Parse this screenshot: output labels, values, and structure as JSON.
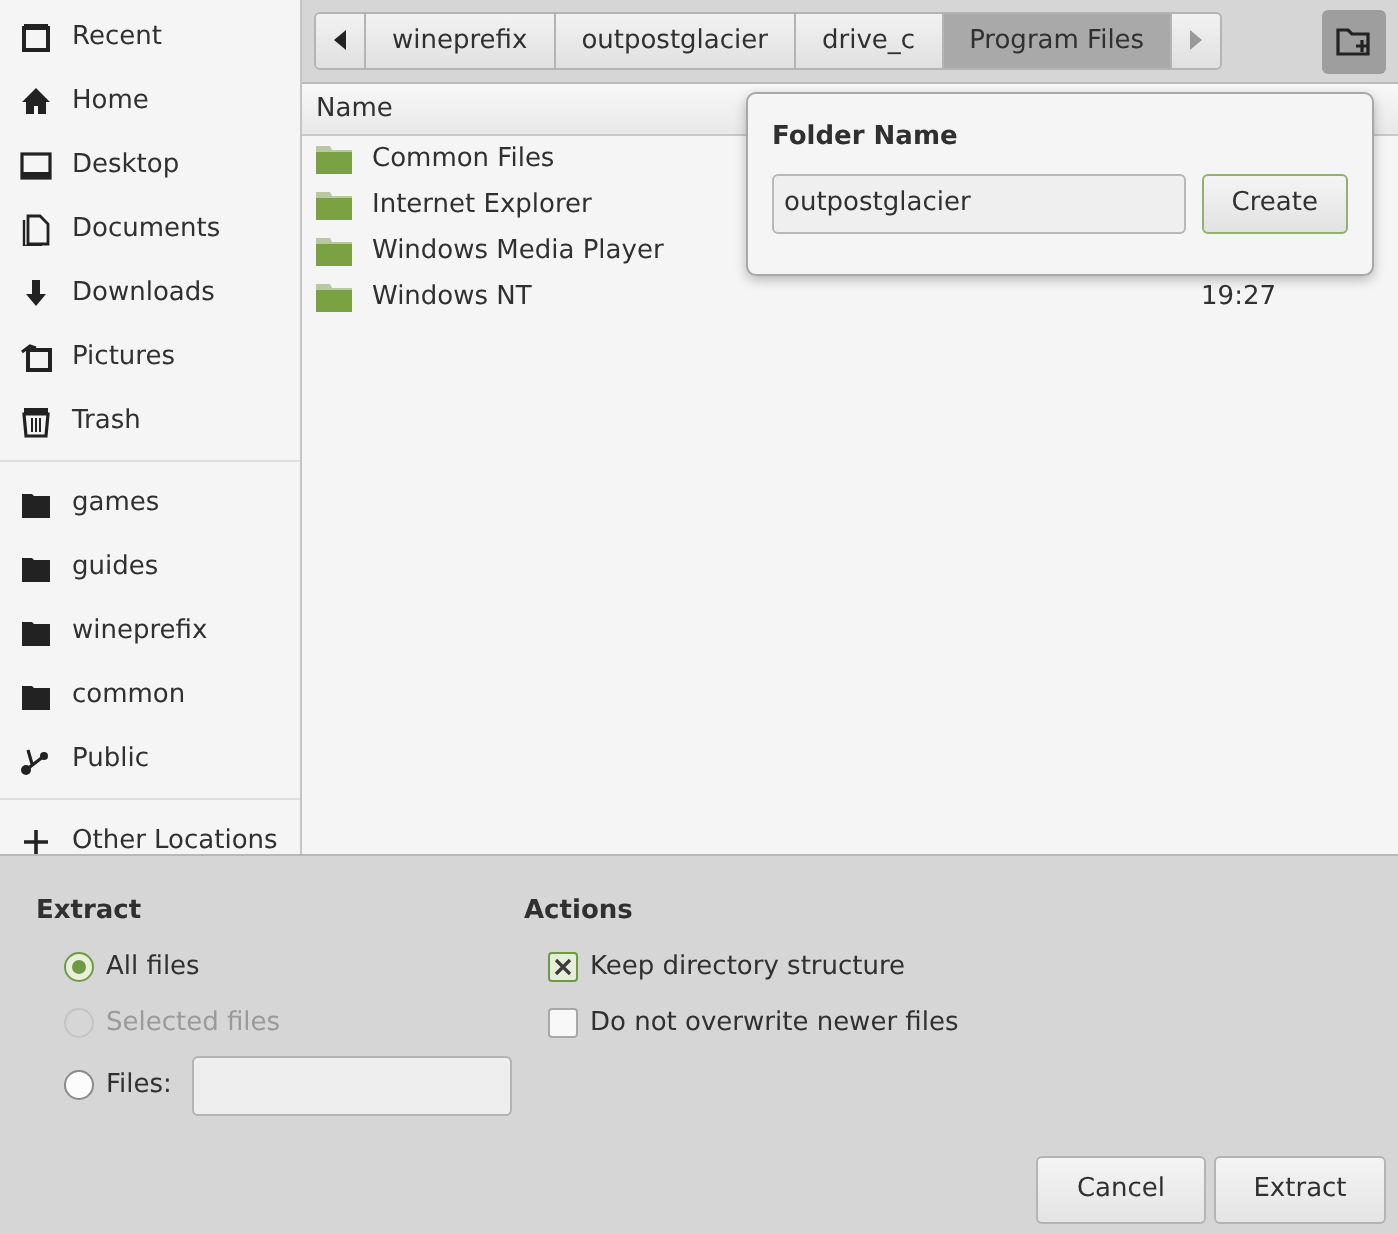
{
  "sidebar": {
    "sections": [
      {
        "items": [
          {
            "label": "Recent",
            "kind": "recent"
          },
          {
            "label": "Home",
            "kind": "home"
          },
          {
            "label": "Desktop",
            "kind": "desktop"
          },
          {
            "label": "Documents",
            "kind": "documents"
          },
          {
            "label": "Downloads",
            "kind": "downloads"
          },
          {
            "label": "Pictures",
            "kind": "pictures"
          },
          {
            "label": "Trash",
            "kind": "trash"
          }
        ]
      },
      {
        "items": [
          {
            "label": "games",
            "kind": "folder"
          },
          {
            "label": "guides",
            "kind": "folder"
          },
          {
            "label": "wineprefix",
            "kind": "folder"
          },
          {
            "label": "common",
            "kind": "folder"
          },
          {
            "label": "Public",
            "kind": "share"
          }
        ]
      },
      {
        "items": [
          {
            "label": "Other Locations",
            "kind": "plus"
          }
        ]
      }
    ]
  },
  "path_bar": {
    "segments": [
      {
        "label": "wineprefix",
        "selected": false
      },
      {
        "label": "outpostglacier",
        "selected": false
      },
      {
        "label": "drive_c",
        "selected": false
      },
      {
        "label": "Program Files",
        "selected": true
      }
    ]
  },
  "file_list": {
    "columns": [
      {
        "label": "Name"
      }
    ],
    "rows": [
      {
        "name": "Common Files"
      },
      {
        "name": "Internet Explorer"
      },
      {
        "name": "Windows Media Player"
      },
      {
        "name": "Windows NT",
        "time": "19:27"
      }
    ]
  },
  "new_folder_popover": {
    "title": "Folder Name",
    "value": "outpostglacier",
    "button": "Create"
  },
  "extract": {
    "title": "Extract",
    "options": [
      {
        "label": "All files",
        "selected": true,
        "disabled": false
      },
      {
        "label": "Selected files",
        "selected": false,
        "disabled": true
      },
      {
        "label": "Files:",
        "selected": false,
        "disabled": false,
        "kind": "field"
      }
    ]
  },
  "actions": {
    "title": "Actions",
    "options": [
      {
        "label": "Keep directory structure",
        "checked": true
      },
      {
        "label": "Do not overwrite newer files",
        "checked": false
      }
    ]
  },
  "buttons": [
    "Cancel",
    "Extract"
  ]
}
